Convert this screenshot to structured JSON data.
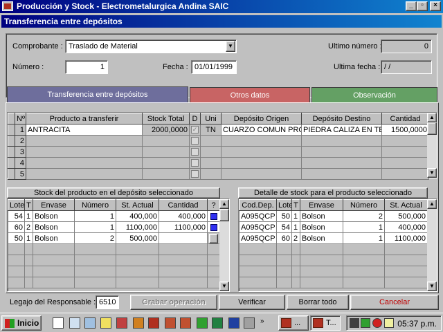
{
  "app": {
    "title": "Producción y Stock - Electrometalurgica Andina SAIC",
    "window_buttons": [
      "_",
      "▫",
      "×"
    ]
  },
  "window": {
    "title": "Transferencia entre depósitos"
  },
  "form": {
    "comprobante_label": "Comprobante :",
    "comprobante_value": "Traslado de Material",
    "numero_label": "Número :",
    "numero_value": "1",
    "fecha_label": "Fecha :",
    "fecha_value": "01/01/1999",
    "ultimo_numero_label": "Ultimo número :",
    "ultimo_numero_value": "0",
    "ultima_fecha_label": "Ultima fecha :",
    "ultima_fecha_value": "/ /"
  },
  "tabs": [
    {
      "label": "Transferencia entre depósitos",
      "color": "#6e6e9c"
    },
    {
      "label": "Otros datos",
      "color": "#c86464"
    },
    {
      "label": "Observación",
      "color": "#64a064"
    }
  ],
  "main_grid": {
    "headers": [
      "Nº",
      "Producto a transferir",
      "Stock Total",
      "D",
      "Uni",
      "Depósito Origen",
      "Depósito Destino",
      "Cantidad"
    ],
    "rows": [
      {
        "n": "1",
        "producto": "ANTRACITA",
        "stock": "2000,0000",
        "d": "✓",
        "uni": "TN",
        "origen": "CUARZO COMUN PRO",
        "destino": "PIEDRA CALIZA EN TE",
        "cantidad": "1500,0000"
      },
      {
        "n": "2",
        "producto": "",
        "stock": "",
        "d": "",
        "uni": "",
        "origen": "",
        "destino": "",
        "cantidad": ""
      },
      {
        "n": "3",
        "producto": "",
        "stock": "",
        "d": "",
        "uni": "",
        "origen": "",
        "destino": "",
        "cantidad": ""
      },
      {
        "n": "4",
        "producto": "",
        "stock": "",
        "d": "",
        "uni": "",
        "origen": "",
        "destino": "",
        "cantidad": ""
      },
      {
        "n": "5",
        "producto": "",
        "stock": "",
        "d": "",
        "uni": "",
        "origen": "",
        "destino": "",
        "cantidad": ""
      }
    ]
  },
  "stock_grid": {
    "caption": "Stock del producto en el depósito seleccionado",
    "headers": [
      "Lote",
      "T",
      "Envase",
      "Número",
      "St. Actual",
      "Cantidad",
      "?"
    ],
    "rows": [
      {
        "lote": "54",
        "t": "1",
        "envase": "Bolson",
        "numero": "1",
        "actual": "400,000",
        "cantidad": "400,000",
        "sel": true
      },
      {
        "lote": "60",
        "t": "2",
        "envase": "Bolson",
        "numero": "1",
        "actual": "1100,000",
        "cantidad": "1100,000",
        "sel": true
      },
      {
        "lote": "50",
        "t": "1",
        "envase": "Bolson",
        "numero": "2",
        "actual": "500,000",
        "cantidad": "",
        "sel": false
      }
    ]
  },
  "detail_grid": {
    "caption": "Detalle de stock para el producto seleccionado",
    "headers": [
      "Cod.Dep.",
      "Lote",
      "T",
      "Envase",
      "Número",
      "St. Actual"
    ],
    "rows": [
      {
        "cod": "A095QCP",
        "lote": "50",
        "t": "1",
        "envase": "Bolson",
        "numero": "2",
        "actual": "500,000"
      },
      {
        "cod": "A095QCP",
        "lote": "54",
        "t": "1",
        "envase": "Bolson",
        "numero": "1",
        "actual": "400,000"
      },
      {
        "cod": "A095QCP",
        "lote": "60",
        "t": "2",
        "envase": "Bolson",
        "numero": "1",
        "actual": "1100,000"
      }
    ]
  },
  "footer": {
    "legajo_label": "Legajo del Responsable :",
    "legajo_value": "6510",
    "grabar": "Grabar operación",
    "verificar": "Verificar",
    "borrar": "Borrar todo",
    "cancelar": "Cancelar"
  },
  "taskbar": {
    "start": "Inicio",
    "tasks": [
      "...",
      "T..."
    ],
    "clock": "05:37 p.m."
  }
}
